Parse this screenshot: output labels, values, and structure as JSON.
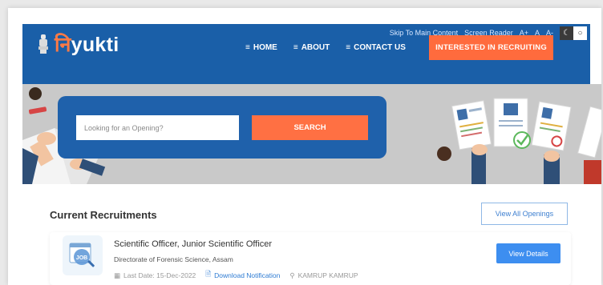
{
  "header": {
    "logo_text_prefix": "नि",
    "logo_text_suffix": "yukti",
    "utility": {
      "skip": "Skip To Main Content",
      "screen_reader": "Screen Reader",
      "font_increase": "A+",
      "font_normal": "A",
      "font_decrease": "A-",
      "dark_mode_icon": "moon-icon",
      "light_mode_icon": "sun-icon"
    },
    "nav": {
      "home": "HOME",
      "about": "ABOUT",
      "contact": "CONTACT US"
    },
    "cta": "INTERESTED IN RECRUITING"
  },
  "hero": {
    "search_placeholder": "Looking for an Opening?",
    "search_button": "SEARCH"
  },
  "recruitments": {
    "title": "Current Recruitments",
    "view_all": "View All Openings",
    "jobs": [
      {
        "title": "Scientific Officer, Junior Scientific Officer",
        "org": "Directorate of Forensic Science, Assam",
        "last_date": "Last Date: 15-Dec-2022",
        "download": "Download Notification",
        "location": "KAMRUP KAMRUP",
        "icon_label": "JOB",
        "action": "View Details"
      }
    ]
  },
  "colors": {
    "primary": "#1a5fa8",
    "accent": "#ff6b3d",
    "button_blue": "#3d8ef0"
  }
}
